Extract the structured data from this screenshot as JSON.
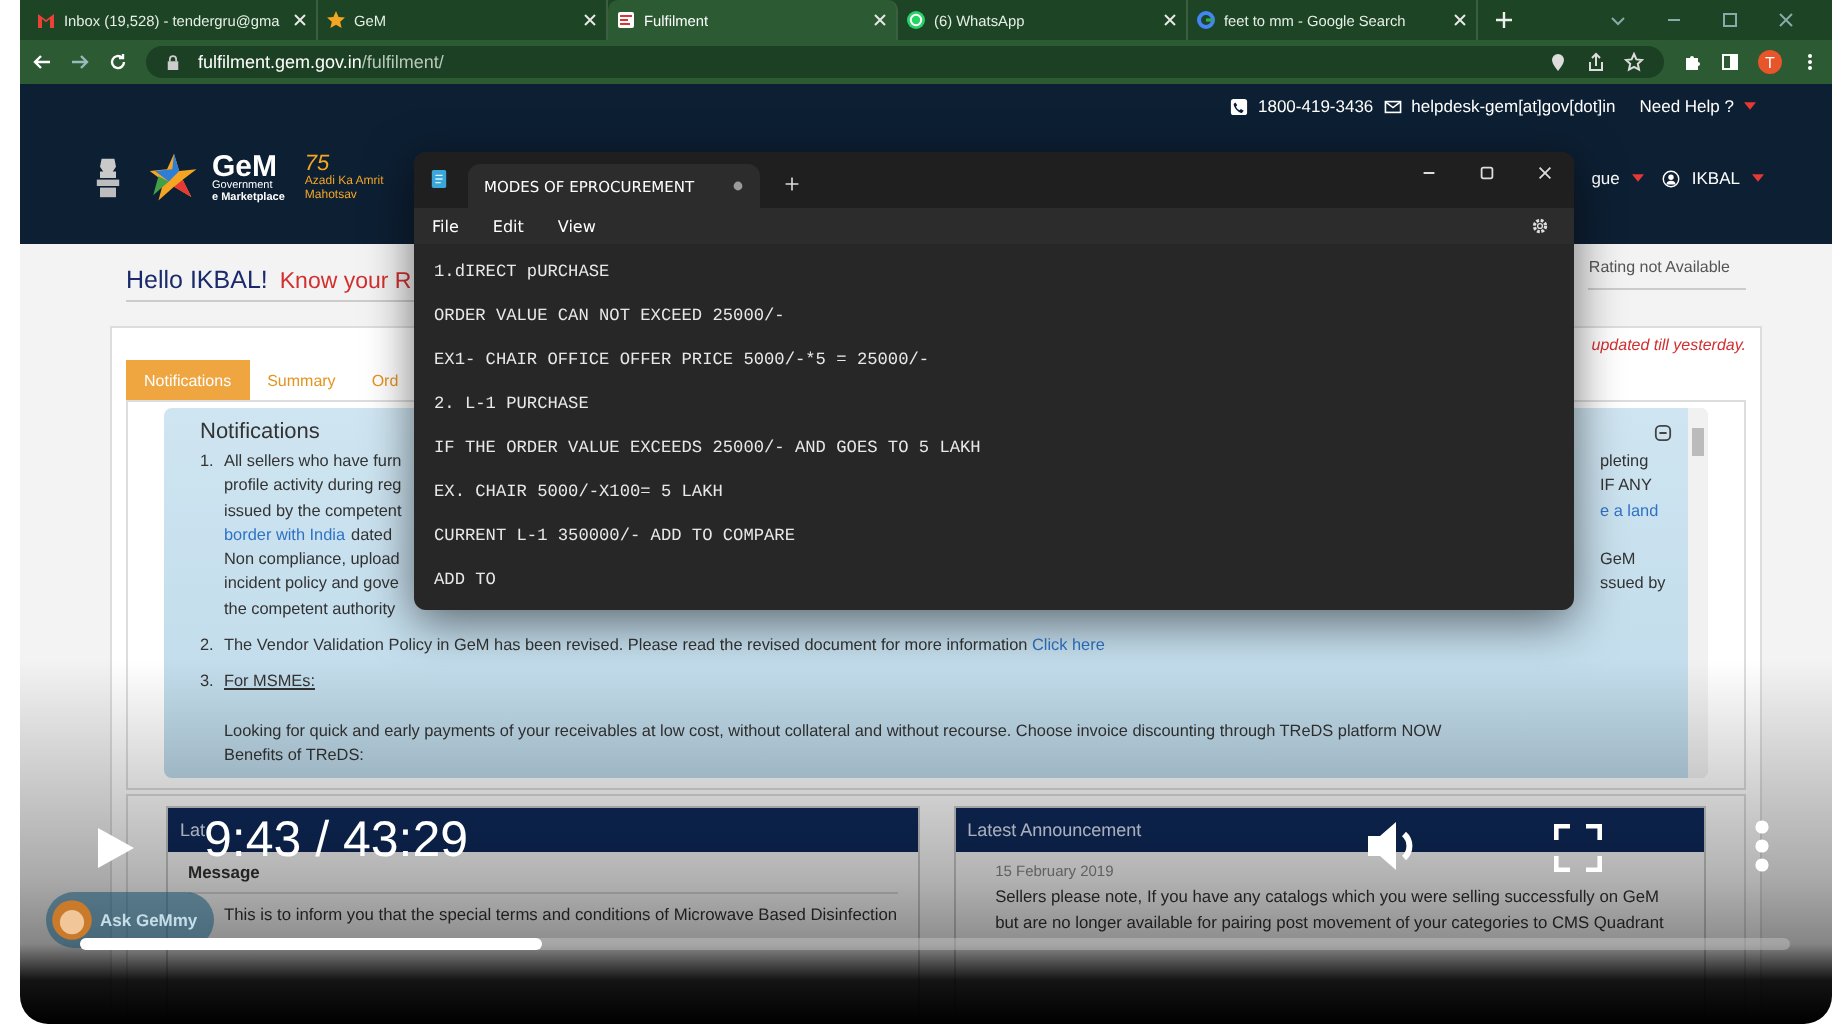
{
  "browser": {
    "tabs": [
      {
        "title": "Inbox (19,528) - tendergru@gma",
        "kind": "mail",
        "selected": false
      },
      {
        "title": "GeM",
        "kind": "star",
        "selected": false
      },
      {
        "title": "Fulfilment",
        "kind": "page",
        "selected": true
      },
      {
        "title": "(6) WhatsApp",
        "kind": "chat",
        "selected": false
      },
      {
        "title": "feet to mm - Google Search",
        "kind": "ring",
        "selected": false
      }
    ],
    "url_host": "fulfilment.gem.gov.in",
    "url_path": "/fulfilment/",
    "avatar": "T"
  },
  "site_header": {
    "phone": "1800-419-3436",
    "email": "helpdesk-gem[at]gov[dot]in",
    "help": "Need Help ?",
    "logo": {
      "name": "GeM",
      "line1": "Government",
      "line2": "e Marketplace",
      "badge_number": "75",
      "badge_text": "Azadi Ka Amrit Mahotsav"
    },
    "language": "gue",
    "user": "IKBAL"
  },
  "greeting": {
    "hello": "Hello IKBAL!",
    "know": "Know your R",
    "rating": "Rating not Available"
  },
  "card": {
    "note": "updated till yesterday.",
    "tabs": [
      {
        "label": "Notifications",
        "selected": true
      },
      {
        "label": "Summary",
        "selected": false
      },
      {
        "label": "Ord",
        "selected": false
      }
    ]
  },
  "notifications": {
    "title": "Notifications",
    "first": {
      "number": "1.",
      "lines": [
        {
          "left": [
            {
              "text": "All sellers who have furn",
              "link": false
            }
          ],
          "right": [
            {
              "text": "pleting",
              "link": false
            }
          ]
        },
        {
          "left": [
            {
              "text": "profile activity during reg",
              "link": false
            }
          ],
          "right": [
            {
              "text": "IF ANY",
              "link": false
            }
          ]
        },
        {
          "left": [
            {
              "text": "issued by the competent",
              "link": false
            }
          ],
          "right": [
            {
              "text": "e a land",
              "link": true
            }
          ]
        },
        {
          "left": [
            {
              "text": "border with India",
              "link": true
            },
            {
              "text": "dated",
              "link": false
            }
          ]
        },
        {
          "left": [
            {
              "text": "Non compliance, upload",
              "link": false
            }
          ],
          "right": [
            {
              "text": "GeM",
              "link": false
            }
          ]
        },
        {
          "left": [
            {
              "text": "incident policy and gove",
              "link": false
            }
          ],
          "right": [
            {
              "text": "ssued by",
              "link": false
            }
          ]
        },
        {
          "left": [
            {
              "text": "the competent authority",
              "link": false
            }
          ]
        }
      ]
    },
    "second": {
      "number": "2.",
      "text": "The Vendor Validation Policy in GeM has been revised. Please read the revised document for more information",
      "link": "Click here"
    },
    "third": {
      "number": "3.",
      "title": "For MSMEs:",
      "paragraph": "Looking for quick and early payments of your receivables at low cost, without collateral and without recourse. Choose invoice discounting through TReDS platform NOW",
      "subtitle": "Benefits of TReDS:"
    }
  },
  "stqc": {
    "title": "Lat",
    "subheader": "Message",
    "text": "This is to inform you that the special terms and conditions of Microwave Based Disinfection"
  },
  "announcement": {
    "title": "Latest Announcement",
    "date": "15 February 2019",
    "lines": [
      "Sellers please note, If you have any catalogs which you were selling successfully on GeM",
      "but are no longer available for pairing post movement of your categories to CMS Quadrant"
    ]
  },
  "chat": {
    "label": "Ask GeMmy"
  },
  "notepad": {
    "title": "MODES OF EPROCUREMENT",
    "unsaved": true,
    "menu": [
      "File",
      "Edit",
      "View"
    ],
    "lines": [
      "1.dIRECT pURCHASE",
      "ORDER VALUE CAN NOT EXCEED 25000/-",
      "EX1- CHAIR OFFICE OFFER PRICE 5000/-*5 = 25000/-",
      "2. L-1 PURCHASE",
      "IF THE ORDER VALUE EXCEEDS 25000/- AND GOES TO 5 LAKH",
      "EX. CHAIR 5000/-X100= 5 LAKH",
      "CURRENT L-1 350000/- ADD TO COMPARE",
      "ADD TO"
    ]
  },
  "video": {
    "time": "9:43 / 43:29",
    "playing": false,
    "level": 0.27
  }
}
